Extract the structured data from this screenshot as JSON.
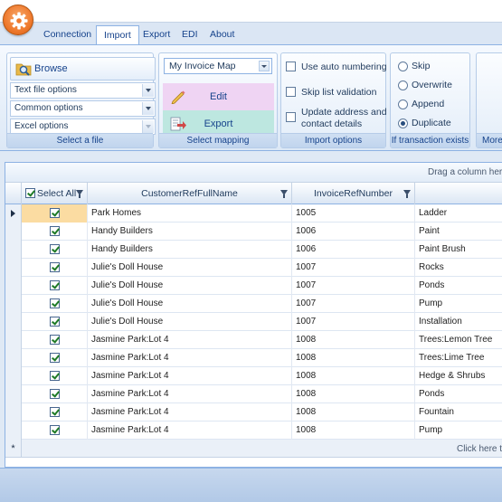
{
  "tabs": [
    "Connection",
    "Import",
    "Export",
    "EDI",
    "About"
  ],
  "active_tab": "Import",
  "ribbon": {
    "select_file": {
      "browse_label": "Browse",
      "text_file_options": "Text file options",
      "common_options": "Common options",
      "excel_options": "Excel options",
      "group_label": "Select a file"
    },
    "select_mapping": {
      "mapping_value": "My Invoice Map",
      "edit_label": "Edit",
      "export_label": "Export",
      "group_label": "Select mapping"
    },
    "import_options": {
      "use_auto_numbering": "Use auto numbering",
      "skip_list_validation": "Skip list validation",
      "update_address_line1": "Update address and",
      "update_address_line2": "contact details",
      "group_label": "Import options"
    },
    "if_transaction_exists": {
      "options": [
        "Skip",
        "Overwrite",
        "Append",
        "Duplicate"
      ],
      "selected": "Duplicate",
      "group_label": "If transaction exists"
    },
    "more_group_label": "More"
  },
  "grid": {
    "group_panel_text": "Drag a column here",
    "columns": [
      "Select All",
      "CustomerRefFullName",
      "InvoiceRefNumber",
      ""
    ],
    "rows": [
      {
        "customer": "Park Homes",
        "invoice": "1005",
        "item": "Ladder"
      },
      {
        "customer": "Handy Builders",
        "invoice": "1006",
        "item": "Paint"
      },
      {
        "customer": "Handy Builders",
        "invoice": "1006",
        "item": "Paint Brush"
      },
      {
        "customer": "Julie's Doll House",
        "invoice": "1007",
        "item": "Rocks"
      },
      {
        "customer": "Julie's Doll House",
        "invoice": "1007",
        "item": "Ponds"
      },
      {
        "customer": "Julie's Doll House",
        "invoice": "1007",
        "item": "Pump"
      },
      {
        "customer": "Julie's Doll House",
        "invoice": "1007",
        "item": "Installation"
      },
      {
        "customer": "Jasmine Park:Lot 4",
        "invoice": "1008",
        "item": "Trees:Lemon Tree"
      },
      {
        "customer": "Jasmine Park:Lot 4",
        "invoice": "1008",
        "item": "Trees:Lime Tree"
      },
      {
        "customer": "Jasmine Park:Lot 4",
        "invoice": "1008",
        "item": "Hedge & Shrubs"
      },
      {
        "customer": "Jasmine Park:Lot 4",
        "invoice": "1008",
        "item": "Ponds"
      },
      {
        "customer": "Jasmine Park:Lot 4",
        "invoice": "1008",
        "item": "Fountain"
      },
      {
        "customer": "Jasmine Park:Lot 4",
        "invoice": "1008",
        "item": "Pump"
      }
    ],
    "new_row_text": "Click here to"
  }
}
